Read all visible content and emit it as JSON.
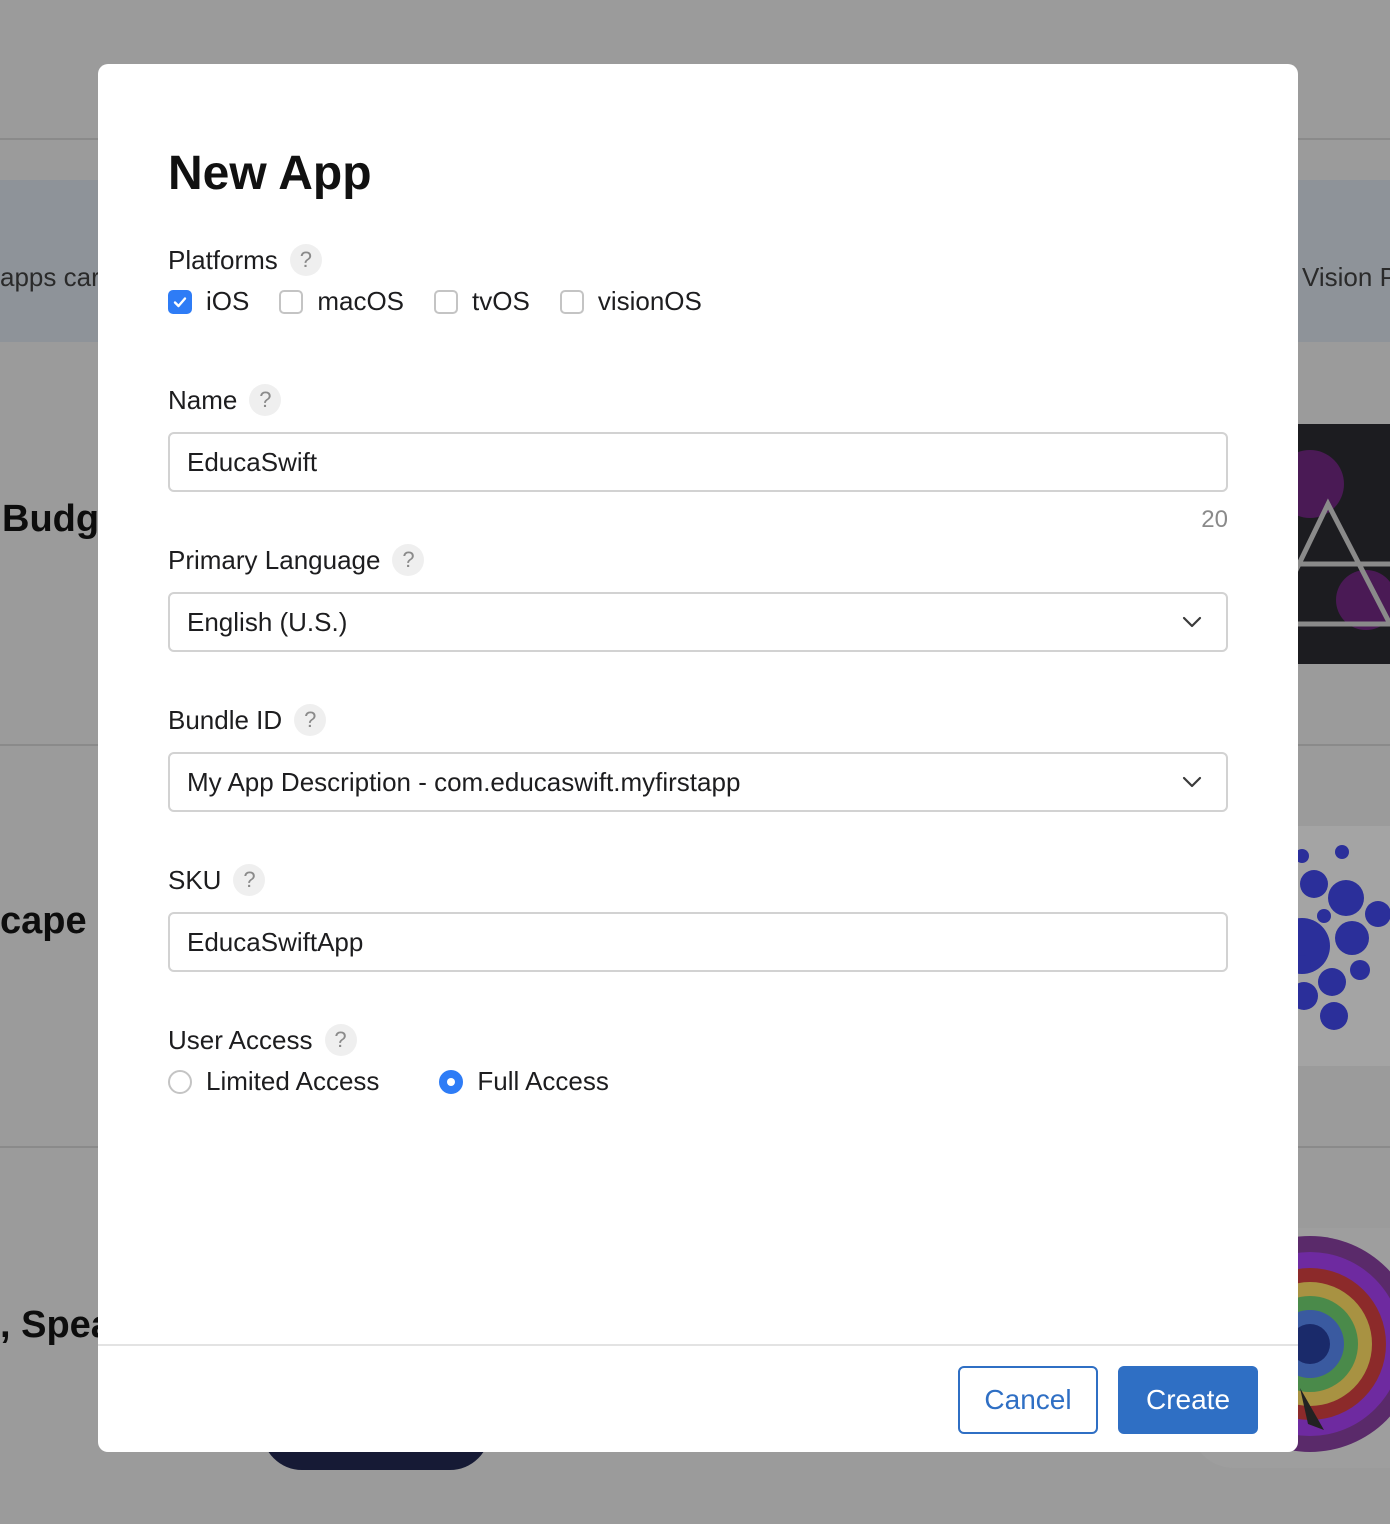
{
  "background": {
    "banner_left": "apps car",
    "banner_right": "Vision P",
    "row1_title": "Budg",
    "row2_title": "cape C",
    "row3_title": ", Spea"
  },
  "modal": {
    "title": "New App",
    "platforms": {
      "label": "Platforms",
      "help": "?",
      "options": [
        {
          "label": "iOS",
          "checked": true
        },
        {
          "label": "macOS",
          "checked": false
        },
        {
          "label": "tvOS",
          "checked": false
        },
        {
          "label": "visionOS",
          "checked": false
        }
      ]
    },
    "name": {
      "label": "Name",
      "help": "?",
      "value": "EducaSwift",
      "counter": "20"
    },
    "primary_language": {
      "label": "Primary Language",
      "help": "?",
      "value": "English (U.S.)"
    },
    "bundle_id": {
      "label": "Bundle ID",
      "help": "?",
      "value": "My App Description - com.educaswift.myfirstapp"
    },
    "sku": {
      "label": "SKU",
      "help": "?",
      "value": "EducaSwiftApp"
    },
    "user_access": {
      "label": "User Access",
      "help": "?",
      "options": [
        {
          "label": "Limited Access",
          "selected": false
        },
        {
          "label": "Full Access",
          "selected": true
        }
      ]
    },
    "buttons": {
      "cancel": "Cancel",
      "create": "Create"
    }
  },
  "colors": {
    "accent": "#2e7cf6",
    "button_primary": "#2f6fc4",
    "overlay": "#9b9b9b"
  }
}
